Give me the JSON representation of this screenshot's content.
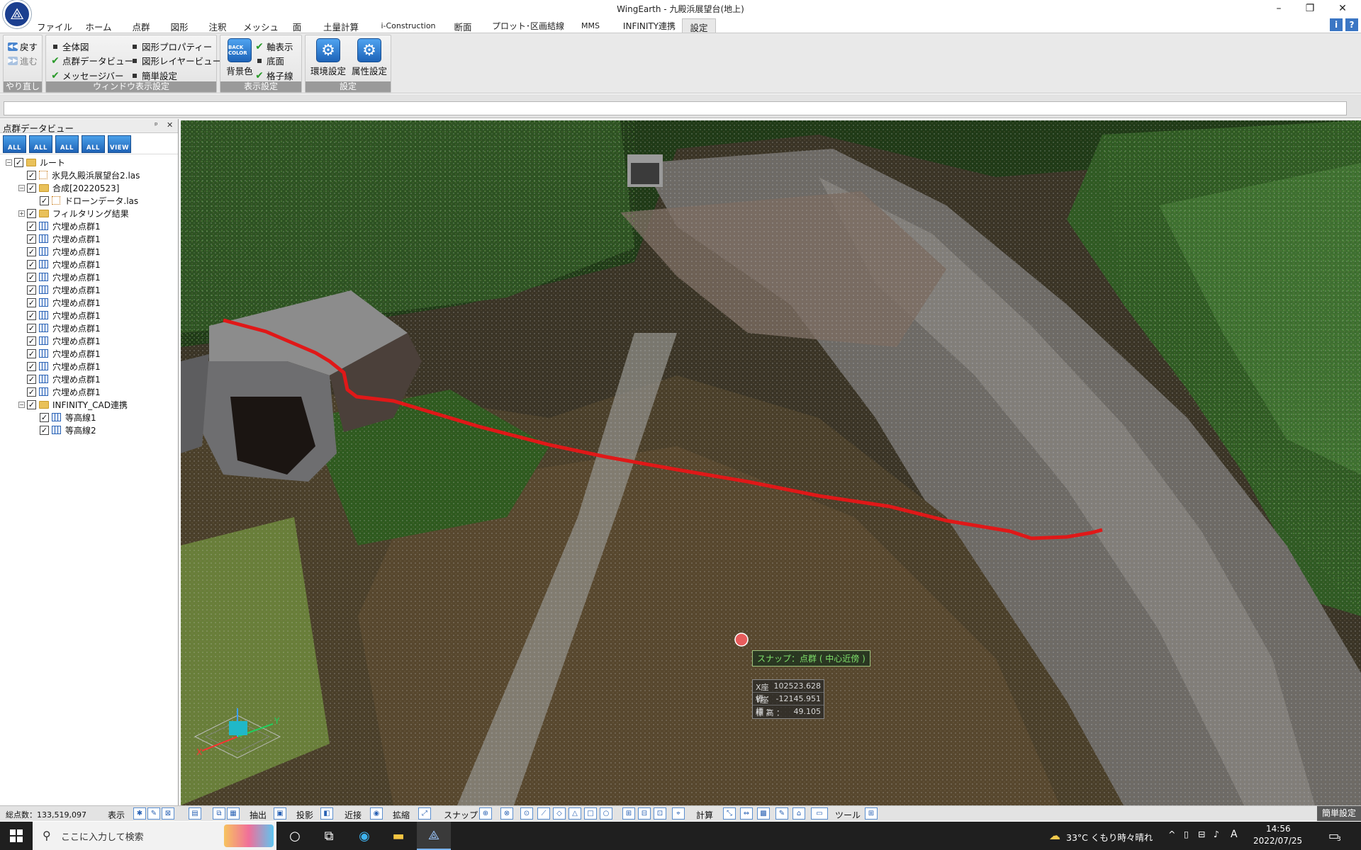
{
  "window": {
    "title": "WingEarth - 九殿浜展望台(地上)",
    "minimize": "–",
    "restore": "❐",
    "close": "✕"
  },
  "menu": {
    "tabs": [
      "ファイル",
      "ホーム",
      "点群",
      "図形",
      "注釈",
      "メッシュ",
      "面",
      "土量計算",
      "i-Construction",
      "断面",
      "プロット･区画結線",
      "MMS",
      "INFINITY連携",
      "設定"
    ],
    "active": "設定"
  },
  "ribbon": {
    "undo_group": {
      "label": "やり直し",
      "back": "戻す",
      "forward": "進む"
    },
    "window_group": {
      "label": "ウィンドウ表示設定",
      "items": [
        {
          "text": "全体図",
          "mark": "dot"
        },
        {
          "text": "点群データビュー",
          "mark": "check"
        },
        {
          "text": "メッセージバー",
          "mark": "check"
        },
        {
          "text": "図形プロパティー",
          "mark": "dot"
        },
        {
          "text": "図形レイヤービュー",
          "mark": "dot"
        },
        {
          "text": "簡単設定",
          "mark": "dot"
        }
      ]
    },
    "display_group": {
      "label": "表示設定",
      "bg_color": "背景色",
      "bg_icon_text": "BACK COLOR",
      "items": [
        {
          "text": "軸表示",
          "mark": "check"
        },
        {
          "text": "底面",
          "mark": "dot"
        },
        {
          "text": "格子線",
          "mark": "check"
        }
      ]
    },
    "settings_group": {
      "label": "設定",
      "env": "環境設定",
      "attr": "属性設定"
    }
  },
  "panel": {
    "title": "点群データビュー",
    "pin": "ᵖ",
    "close": "✕",
    "tools": [
      "ALL",
      "ALL",
      "ALL",
      "ALL",
      "VIEW"
    ],
    "tree": [
      {
        "level": 0,
        "expander": "−",
        "checked": true,
        "icon": "folder",
        "label": "ルート"
      },
      {
        "level": 1,
        "expander": "",
        "checked": true,
        "icon": "file",
        "label": "氷見久殿浜展望台2.las"
      },
      {
        "level": 1,
        "expander": "−",
        "checked": true,
        "icon": "folder",
        "label": "合成[20220523]"
      },
      {
        "level": 2,
        "expander": "",
        "checked": true,
        "icon": "file",
        "label": "ドローンデータ.las"
      },
      {
        "level": 1,
        "expander": "+",
        "checked": true,
        "icon": "folder",
        "label": "フィルタリング結果"
      },
      {
        "level": 1,
        "expander": "",
        "checked": true,
        "icon": "grid",
        "label": "穴埋め点群1"
      },
      {
        "level": 1,
        "expander": "",
        "checked": true,
        "icon": "grid",
        "label": "穴埋め点群1"
      },
      {
        "level": 1,
        "expander": "",
        "checked": true,
        "icon": "grid",
        "label": "穴埋め点群1"
      },
      {
        "level": 1,
        "expander": "",
        "checked": true,
        "icon": "grid",
        "label": "穴埋め点群1"
      },
      {
        "level": 1,
        "expander": "",
        "checked": true,
        "icon": "grid",
        "label": "穴埋め点群1"
      },
      {
        "level": 1,
        "expander": "",
        "checked": true,
        "icon": "grid",
        "label": "穴埋め点群1"
      },
      {
        "level": 1,
        "expander": "",
        "checked": true,
        "icon": "grid",
        "label": "穴埋め点群1"
      },
      {
        "level": 1,
        "expander": "",
        "checked": true,
        "icon": "grid",
        "label": "穴埋め点群1"
      },
      {
        "level": 1,
        "expander": "",
        "checked": true,
        "icon": "grid",
        "label": "穴埋め点群1"
      },
      {
        "level": 1,
        "expander": "",
        "checked": true,
        "icon": "grid",
        "label": "穴埋め点群1"
      },
      {
        "level": 1,
        "expander": "",
        "checked": true,
        "icon": "grid",
        "label": "穴埋め点群1"
      },
      {
        "level": 1,
        "expander": "",
        "checked": true,
        "icon": "grid",
        "label": "穴埋め点群1"
      },
      {
        "level": 1,
        "expander": "",
        "checked": true,
        "icon": "grid",
        "label": "穴埋め点群1"
      },
      {
        "level": 1,
        "expander": "",
        "checked": true,
        "icon": "grid",
        "label": "穴埋め点群1"
      },
      {
        "level": 1,
        "expander": "−",
        "checked": true,
        "icon": "folder",
        "label": "INFINITY_CAD連携"
      },
      {
        "level": 2,
        "expander": "",
        "checked": true,
        "icon": "grid",
        "label": "等高線1"
      },
      {
        "level": 2,
        "expander": "",
        "checked": true,
        "icon": "grid",
        "label": "等高線2"
      }
    ]
  },
  "viewport": {
    "snap_label": "スナップ：点群 ( 中心近傍 )",
    "coords": [
      {
        "label": "X座標 ：",
        "value": "102523.628"
      },
      {
        "label": "Y座標 ：",
        "value": "-12145.951"
      },
      {
        "label": "標 高 ：",
        "value": "49.105"
      }
    ],
    "axis_labels": {
      "x": "X",
      "y": "Y"
    }
  },
  "statusbar": {
    "point_count": "総点数：133,519,097",
    "display": "表示",
    "extract": "抽出",
    "project": "投影",
    "near": "近接",
    "expand": "拡縮",
    "snap": "スナップ",
    "calc": "計算",
    "tool": "ツール",
    "simple_setting": "簡単設定"
  },
  "taskbar": {
    "search_placeholder": "ここに入力して検索",
    "weather": "33°C くもり時々晴れ",
    "ime": "A",
    "time": "14:56",
    "date": "2022/07/25",
    "notif_count": "3"
  },
  "colors": {
    "accent": "#1d63b8",
    "snap_text": "#7fe06a",
    "red_line": "#e01818"
  }
}
